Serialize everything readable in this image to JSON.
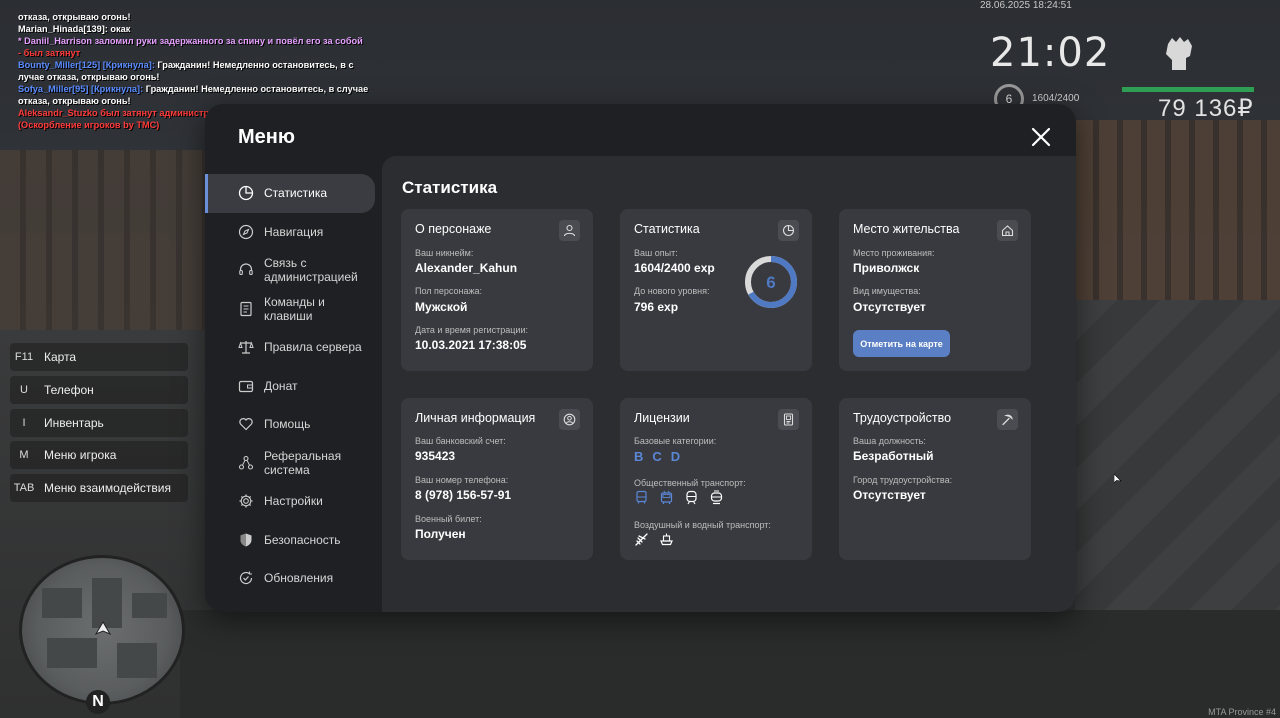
{
  "chat": [
    {
      "text": " отказа, открываю огонь!",
      "color": "white"
    },
    {
      "text": "Marian_Hinada[139]: окак",
      "color": "white"
    },
    {
      "text": "* Daniil_Harrison заломил руки задержанного за спину и повёл его за собой",
      "color": "purple"
    },
    {
      "text": " - был затянут",
      "color": "red"
    },
    {
      "text_name": "Bounty_Miller[125] [Крикнула]:",
      "text": " Гражданин! Немедленно остановитесь, в с",
      "color": "white"
    },
    {
      "text": "лучае отказа, открываю огонь!",
      "color": "white"
    },
    {
      "text_name": "Sofya_Miller[95] [Крикнула]:",
      "text": " Гражданин! Немедленно остановитесь, в случае",
      "color": "white"
    },
    {
      "text": " отказа, открываю огонь!",
      "color": "white"
    },
    {
      "text": "Aleksandr_Stuzko был затянут администратором Anthony_Manrique (1 час.)",
      "color": "red"
    },
    {
      "text": "(Оскорбление игроков by TMC)",
      "color": "red"
    }
  ],
  "hud": {
    "datetime": "28.06.2025 18:24:51",
    "time": "21:02",
    "level": "6",
    "exp": "1604/2400",
    "money": "79 136₽"
  },
  "keybinds": [
    {
      "key": "F11",
      "label": "Карта"
    },
    {
      "key": "U",
      "label": "Телефон"
    },
    {
      "key": "I",
      "label": "Инвентарь"
    },
    {
      "key": "M",
      "label": "Меню игрока"
    },
    {
      "key": "TAB",
      "label": "Меню взаимодействия"
    }
  ],
  "compass": "N",
  "watermark": "MTA Province #4",
  "menu": {
    "title": "Меню",
    "nav": [
      {
        "label": "Статистика",
        "icon": "pie-chart-icon",
        "active": true
      },
      {
        "label": "Навигация",
        "icon": "compass-icon"
      },
      {
        "label": "Связь с администрацией",
        "icon": "headset-icon"
      },
      {
        "label": "Команды и клавиши",
        "icon": "document-icon"
      },
      {
        "label": "Правила сервера",
        "icon": "scales-icon"
      },
      {
        "label": "Донат",
        "icon": "wallet-icon"
      },
      {
        "label": "Помощь",
        "icon": "heart-hands-icon"
      },
      {
        "label": "Реферальная система",
        "icon": "network-icon"
      },
      {
        "label": "Настройки",
        "icon": "gear-icon"
      },
      {
        "label": "Безопасность",
        "icon": "shield-icon"
      },
      {
        "label": "Обновления",
        "icon": "refresh-check-icon"
      }
    ],
    "content_title": "Статистика",
    "cards": {
      "character": {
        "title": "О персонаже",
        "nickname_label": "Ваш никнейм:",
        "nickname": "Alexander_Kahun",
        "gender_label": "Пол персонажа:",
        "gender": "Мужской",
        "reg_label": "Дата и время регистрации:",
        "reg": "10.03.2021 17:38:05"
      },
      "stats": {
        "title": "Статистика",
        "exp_label": "Ваш опыт:",
        "exp": "1604/2400 exp",
        "next_label": "До нового уровня:",
        "next": "796 exp",
        "level": "6",
        "progress": 0.668
      },
      "residence": {
        "title": "Место жительства",
        "place_label": "Место проживания:",
        "place": "Приволжск",
        "property_label": "Вид имущества:",
        "property": "Отсутствует",
        "button": "Отметить на карте"
      },
      "personal": {
        "title": "Личная информация",
        "bank_label": "Ваш банковский счет:",
        "bank": "935423",
        "phone_label": "Ваш номер телефона:",
        "phone": "8 (978) 156-57-91",
        "military_label": "Военный билет:",
        "military": "Получен"
      },
      "licenses": {
        "title": "Лицензии",
        "base_label": "Базовые категории:",
        "base": [
          "B",
          "C",
          "D"
        ],
        "public_label": "Общественный транспорт:",
        "air_label": "Воздушный и водный транспорт:"
      },
      "employment": {
        "title": "Трудоустройство",
        "position_label": "Ваша должность:",
        "position": "Безработный",
        "city_label": "Город трудоустройства:",
        "city": "Отсутствует"
      }
    }
  },
  "colors": {
    "accent": "#5a7fc4",
    "panel": "#1f2023",
    "card": "#393a3f"
  }
}
